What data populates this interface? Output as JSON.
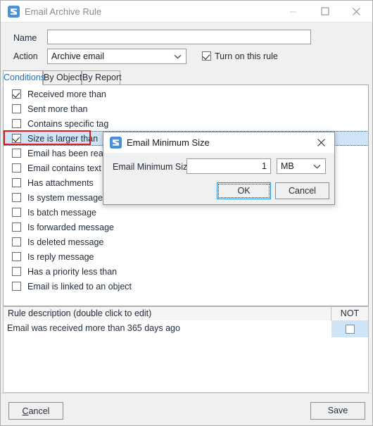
{
  "window": {
    "title": "Email Archive Rule",
    "icon": "email-app-icon",
    "controls": {
      "minimize": "minimize-icon",
      "maximize": "maximize-icon",
      "close": "close-icon"
    }
  },
  "form": {
    "name_label": "Name",
    "name_value": "",
    "name_placeholder": "",
    "action_label": "Action",
    "action_value": "Archive email",
    "turn_on_label": "Turn on this rule",
    "turn_on_checked": true
  },
  "tabs": [
    {
      "label": "Conditions",
      "active": true
    },
    {
      "label": "By Object",
      "active": false
    },
    {
      "label": "By Report",
      "active": false
    }
  ],
  "conditions": [
    {
      "label": "Received more than",
      "checked": true,
      "selected": false
    },
    {
      "label": "Sent more than",
      "checked": false,
      "selected": false
    },
    {
      "label": "Contains specific tag",
      "checked": false,
      "selected": false
    },
    {
      "label": "Size is larger than",
      "checked": true,
      "selected": true
    },
    {
      "label": "Email has been read",
      "checked": false,
      "selected": false
    },
    {
      "label": "Email contains text",
      "checked": false,
      "selected": false
    },
    {
      "label": "Has attachments",
      "checked": false,
      "selected": false
    },
    {
      "label": "Is system message",
      "checked": false,
      "selected": false
    },
    {
      "label": "Is batch message",
      "checked": false,
      "selected": false
    },
    {
      "label": "Is forwarded message",
      "checked": false,
      "selected": false
    },
    {
      "label": "Is deleted message",
      "checked": false,
      "selected": false
    },
    {
      "label": "Is reply message",
      "checked": false,
      "selected": false
    },
    {
      "label": "Has a priority less than",
      "checked": false,
      "selected": false
    },
    {
      "label": "Email is linked to an object",
      "checked": false,
      "selected": false
    }
  ],
  "annotation": {
    "color": "#e61919",
    "target": "Size is larger than"
  },
  "rule_grid": {
    "headers": [
      "Rule description (double click to edit)",
      "NOT"
    ],
    "rows": [
      {
        "description": "Email was received more than 365 days ago",
        "not_checked": false
      }
    ]
  },
  "footer": {
    "cancel_label": "Cancel",
    "cancel_accel": "C",
    "cancel_rest": "ancel",
    "save_label": "Save"
  },
  "dialog": {
    "title": "Email Minimum Size",
    "icon": "email-app-icon",
    "close_icon": "close-icon",
    "field_label": "Email Minimum Size",
    "field_value": "1",
    "unit_value": "MB",
    "ok_label": "OK",
    "cancel_label": "Cancel"
  },
  "colors": {
    "accent": "#1a72c4",
    "icon_blue": "#4a90d9",
    "selection_blue": "#cfe4f7",
    "annotation_red": "#e61919"
  }
}
